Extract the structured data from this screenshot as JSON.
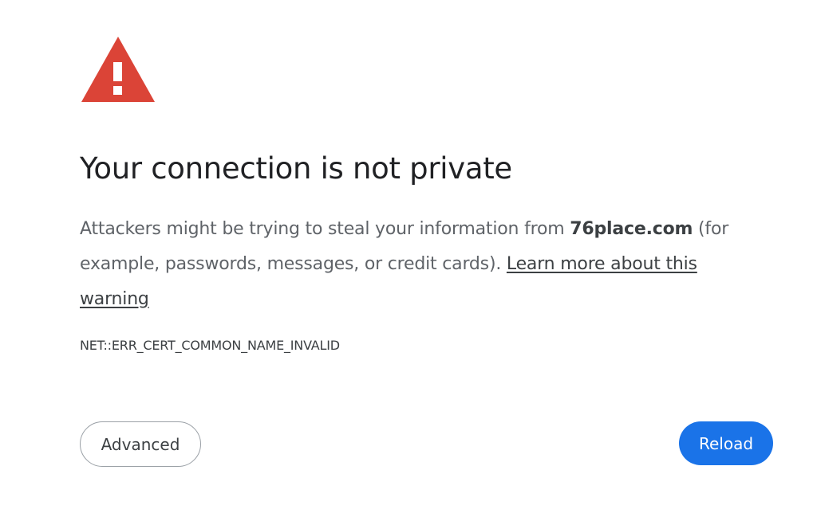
{
  "icon": {
    "name": "warning-triangle-icon",
    "color": "#db4437"
  },
  "title": "Your connection is not private",
  "message": {
    "prefix": "Attackers might be trying to steal your information from ",
    "domain": "76place.com",
    "suffix": " (for example, passwords, messages, or credit cards). ",
    "learn_more": "Learn more about this warning"
  },
  "error_code": "NET::ERR_CERT_COMMON_NAME_INVALID",
  "buttons": {
    "advanced": "Advanced",
    "reload": "Reload"
  },
  "colors": {
    "primary": "#1a73e8",
    "danger": "#db4437"
  }
}
